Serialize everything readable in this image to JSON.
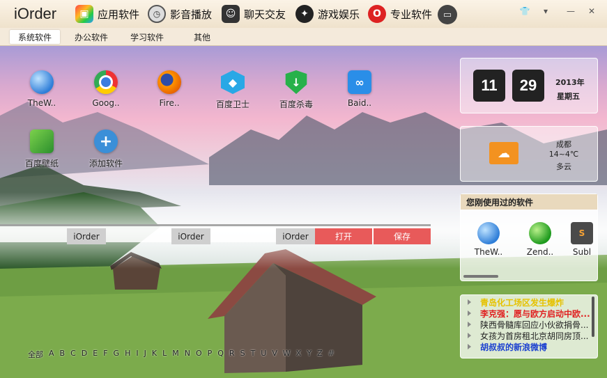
{
  "app": {
    "title": "iOrder"
  },
  "header": {
    "categories": [
      {
        "label": "应用软件",
        "icon": "apps-icon"
      },
      {
        "label": "影音播放",
        "icon": "media-icon"
      },
      {
        "label": "聊天交友",
        "icon": "chat-icon"
      },
      {
        "label": "游戏娱乐",
        "icon": "game-icon"
      },
      {
        "label": "专业软件",
        "icon": "pro-icon"
      }
    ],
    "window_controls": [
      "skin-icon",
      "menu-icon",
      "minimize-icon",
      "close-icon"
    ]
  },
  "tabs": [
    {
      "label": "系统软件",
      "active": true
    },
    {
      "label": "办公软件",
      "active": false
    },
    {
      "label": "学习软件",
      "active": false
    },
    {
      "label": "其他",
      "active": false
    }
  ],
  "apps": [
    {
      "label": "TheW..",
      "icon": "globe-icon"
    },
    {
      "label": "Goog..",
      "icon": "chrome-icon"
    },
    {
      "label": "Fire..",
      "icon": "firefox-icon"
    },
    {
      "label": "百度卫士",
      "icon": "baidu-guard-icon"
    },
    {
      "label": "百度杀毒",
      "icon": "baidu-antivirus-icon"
    },
    {
      "label": "Baid..",
      "icon": "baidu-cloud-icon"
    },
    {
      "label": "百度壁纸",
      "icon": "baidu-wallpaper-icon"
    },
    {
      "label": "添加软件",
      "icon": "add-icon"
    }
  ],
  "strip": {
    "items": [
      "iOrder",
      "iOrder",
      "iOrder"
    ],
    "open": "打开",
    "save": "保存"
  },
  "alphabet": [
    "全部",
    "A",
    "B",
    "C",
    "D",
    "E",
    "F",
    "G",
    "H",
    "I",
    "J",
    "K",
    "L",
    "M",
    "N",
    "O",
    "P",
    "Q",
    "R",
    "S",
    "T",
    "U",
    "V",
    "W",
    "X",
    "Y",
    "Z",
    "#"
  ],
  "clock": {
    "hour": "11",
    "minute": "29",
    "year": "2013年",
    "weekday": "星期五"
  },
  "weather": {
    "city": "成都",
    "temp": "14~4℃",
    "desc": "多云",
    "icon": "sun-cloud-icon"
  },
  "recent": {
    "title": "您刚使用过的软件",
    "items": [
      {
        "label": "TheW..",
        "icon": "globe-icon"
      },
      {
        "label": "Zend..",
        "icon": "zend-icon"
      },
      {
        "label": "Subl",
        "icon": "sublime-icon"
      }
    ]
  },
  "news": [
    {
      "text": "青岛化工场区发生爆炸",
      "color": "#e6c200"
    },
    {
      "text": "李克强：愿与欧方启动中欧...",
      "color": "#e02020"
    },
    {
      "text": "陕西骨髓库回应小伙欲捐骨...",
      "color": "#222222"
    },
    {
      "text": "女孩为首房租北京胡同房顶...",
      "color": "#222222"
    },
    {
      "text": "胡叔叔的新浪微博",
      "color": "#1a3fd0"
    }
  ]
}
